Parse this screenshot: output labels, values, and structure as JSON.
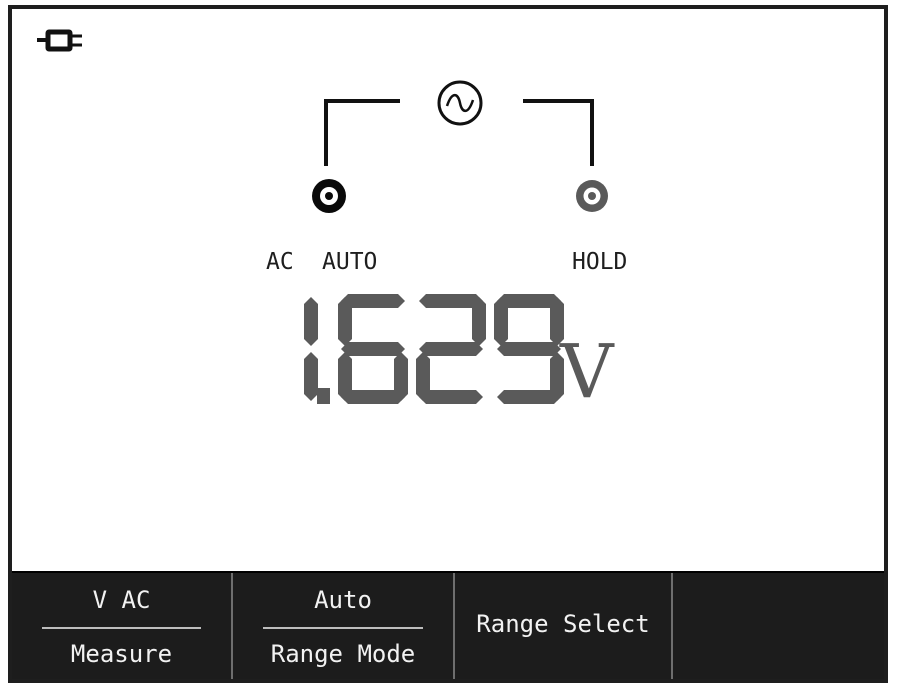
{
  "status_bar": {
    "power_icon": "ac-plug-icon"
  },
  "diagram": {
    "source_icon": "ac-sine-source-icon",
    "left_terminal_icon": "terminal-active-icon",
    "right_terminal_icon": "terminal-inactive-icon"
  },
  "indicators": {
    "mode": "AC",
    "range": "AUTO",
    "hold": "HOLD"
  },
  "reading": {
    "value": "1.629",
    "unit": "V"
  },
  "softkeys": [
    {
      "top": "V AC",
      "bottom": "Measure"
    },
    {
      "top": "Auto",
      "bottom": "Range Mode"
    },
    {
      "label": "Range Select"
    }
  ],
  "colors": {
    "text": "#1e1e1e",
    "segment_fill": "#5a5a5a",
    "softkey_bg": "#1c1c1c",
    "softkey_text": "#f2f2f2"
  }
}
